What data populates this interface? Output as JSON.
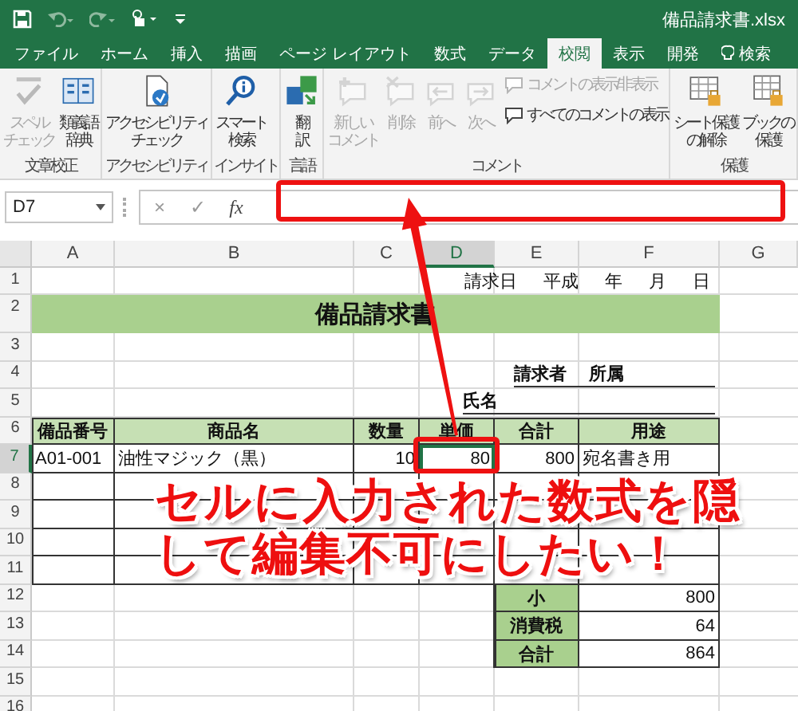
{
  "title_bar": {
    "title": "備品請求書.xlsx"
  },
  "tabs": [
    {
      "label": "ファイル",
      "kind": "tab",
      "selected": false
    },
    {
      "label": "ホーム",
      "kind": "tab",
      "selected": false
    },
    {
      "label": "挿入",
      "kind": "tab",
      "selected": false
    },
    {
      "label": "描画",
      "kind": "tab",
      "selected": false
    },
    {
      "label": "ページ レイアウト",
      "kind": "tab",
      "selected": false
    },
    {
      "label": "数式",
      "kind": "tab",
      "selected": false
    },
    {
      "label": "データ",
      "kind": "tab",
      "selected": false
    },
    {
      "label": "校閲",
      "kind": "tab",
      "selected": true
    },
    {
      "label": "表示",
      "kind": "tab",
      "selected": false
    },
    {
      "label": "開発",
      "kind": "tab",
      "selected": false
    },
    {
      "label": "検索",
      "kind": "search",
      "selected": false
    }
  ],
  "ribbon": {
    "groups": [
      {
        "label": "文章校正",
        "buttons": [
          {
            "kind": "large",
            "lines": [
              "スペル",
              "チェック"
            ],
            "disabled": true
          },
          {
            "kind": "large",
            "lines": [
              "類義語",
              "辞典"
            ],
            "disabled": false
          }
        ]
      },
      {
        "label": "アクセシビリティ",
        "buttons": [
          {
            "kind": "large",
            "lines": [
              "アクセシビリティ",
              "チェック"
            ],
            "disabled": false
          }
        ]
      },
      {
        "label": "インサイト",
        "buttons": [
          {
            "kind": "large",
            "lines": [
              "スマート",
              "検索"
            ],
            "disabled": false
          }
        ]
      },
      {
        "label": "言語",
        "buttons": [
          {
            "kind": "large",
            "lines": [
              "翻",
              "訳"
            ],
            "disabled": false
          }
        ]
      },
      {
        "label": "コメント",
        "buttons": [
          {
            "kind": "large",
            "lines": [
              "新しい",
              "コメント"
            ],
            "disabled": true
          },
          {
            "kind": "large",
            "lines": [
              "削除"
            ],
            "disabled": true
          },
          {
            "kind": "large",
            "lines": [
              "前へ"
            ],
            "disabled": true
          },
          {
            "kind": "large",
            "lines": [
              "次へ"
            ],
            "disabled": true
          },
          {
            "kind": "small",
            "lines": [
              "コメントの表示/非表示"
            ],
            "disabled": true
          },
          {
            "kind": "small",
            "lines": [
              "すべてのコメントの表示"
            ],
            "disabled": false
          }
        ]
      },
      {
        "label": "保護",
        "buttons": [
          {
            "kind": "large",
            "lines": [
              "シート保護",
              "の解除"
            ],
            "disabled": false
          },
          {
            "kind": "large",
            "lines": [
              "ブックの",
              "保護"
            ],
            "disabled": false
          }
        ]
      }
    ]
  },
  "formula_bar": {
    "name_box": "D7",
    "cancel": "×",
    "enter": "✓",
    "function_label": "fx"
  },
  "sheet": {
    "columns": [
      {
        "label": "A",
        "selected": false
      },
      {
        "label": "B",
        "selected": false
      },
      {
        "label": "C",
        "selected": false
      },
      {
        "label": "D",
        "selected": true
      },
      {
        "label": "E",
        "selected": false
      },
      {
        "label": "F",
        "selected": false
      },
      {
        "label": "G",
        "selected": false
      }
    ],
    "row_numbers": [
      {
        "label": "1",
        "selected": false
      },
      {
        "label": "2",
        "selected": false
      },
      {
        "label": "3",
        "selected": false
      },
      {
        "label": "4",
        "selected": false
      },
      {
        "label": "5",
        "selected": false
      },
      {
        "label": "6",
        "selected": false
      },
      {
        "label": "7",
        "selected": true
      },
      {
        "label": "8",
        "selected": false
      },
      {
        "label": "9",
        "selected": false
      },
      {
        "label": "10",
        "selected": false
      },
      {
        "label": "11",
        "selected": false
      },
      {
        "label": "12",
        "selected": false
      },
      {
        "label": "13",
        "selected": false
      },
      {
        "label": "14",
        "selected": false
      },
      {
        "label": "15",
        "selected": false
      },
      {
        "label": "16",
        "selected": false
      }
    ],
    "date_line": [
      "請求日",
      "平成",
      "年",
      "月",
      "日"
    ],
    "title": "備品請求書",
    "requester": [
      "請求者",
      "所属"
    ],
    "name_label": "氏名",
    "table": {
      "headers": [
        "備品番号",
        "商品名",
        "数量",
        "単価",
        "合計",
        "用途"
      ],
      "rows": [
        {
          "cells": [
            {
              "kind": "text",
              "text": "A01-001",
              "selected": false
            },
            {
              "kind": "text",
              "text": "油性マジック（黒）",
              "selected": false
            },
            {
              "kind": "number",
              "text": "10",
              "selected": false
            },
            {
              "kind": "number",
              "text": "80",
              "selected": true
            },
            {
              "kind": "number",
              "text": "800",
              "selected": false
            },
            {
              "kind": "text",
              "text": "宛名書き用",
              "selected": false
            }
          ]
        }
      ]
    },
    "totals": [
      {
        "label": "小",
        "value": "800"
      },
      {
        "label": "消費税",
        "value": "64"
      },
      {
        "label": "合計",
        "value": "864"
      }
    ]
  },
  "annotation": {
    "lines": [
      "セルに入力された数式を隠",
      "して編集不可にしたい！"
    ]
  }
}
